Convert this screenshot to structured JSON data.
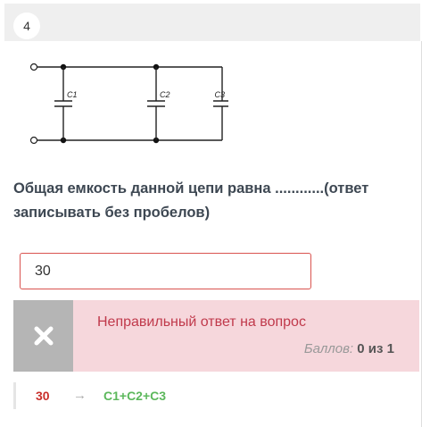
{
  "question": {
    "number": "4",
    "text": "Общая емкость данной цепи равна ............(ответ записывать без пробелов)",
    "answer_value": "30"
  },
  "circuit": {
    "labels": [
      "C1",
      "C2",
      "C3"
    ]
  },
  "feedback": {
    "icon": "close-icon",
    "message": "Неправильный ответ на вопрос",
    "score_label": "Баллов:",
    "score": "0",
    "score_sep": "из",
    "score_max": "1",
    "colors": {
      "bg": "#f6d7dc",
      "text": "#c0394b",
      "iconbox": "#b5b5b5"
    }
  },
  "result": {
    "given": "30",
    "arrow": "→",
    "correct": "C1+C2+C3",
    "colors": {
      "given": "#c9302c",
      "correct": "#5cb85c"
    }
  }
}
